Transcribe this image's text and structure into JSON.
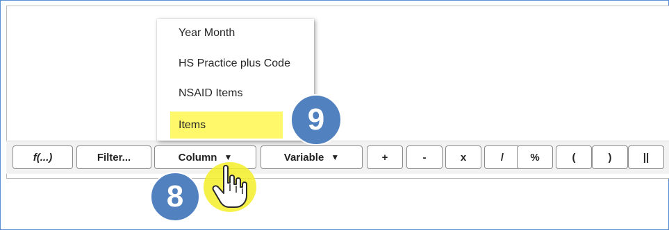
{
  "toolbar": {
    "buttons": {
      "function": "f(...)",
      "filter": "Filter...",
      "column": "Column",
      "variable": "Variable",
      "plus": "+",
      "minus": "-",
      "multiply": "x",
      "divide": "/",
      "percent": "%",
      "open_paren": "(",
      "close_paren": ")",
      "concat": "||"
    },
    "dropdown_caret": "▼"
  },
  "column_menu": {
    "items": [
      "Year Month",
      "HS Practice plus Code",
      "NSAID Items",
      "Items"
    ],
    "highlighted": "Items"
  },
  "annotations": {
    "step_column": "8",
    "step_item": "9"
  },
  "colors": {
    "badge": "#5181bf",
    "highlight": "#fff86a",
    "frame_border": "#5b8fd4"
  },
  "icons": {
    "pointer": "hand-pointer-icon",
    "resize": "resize-grip-icon"
  }
}
